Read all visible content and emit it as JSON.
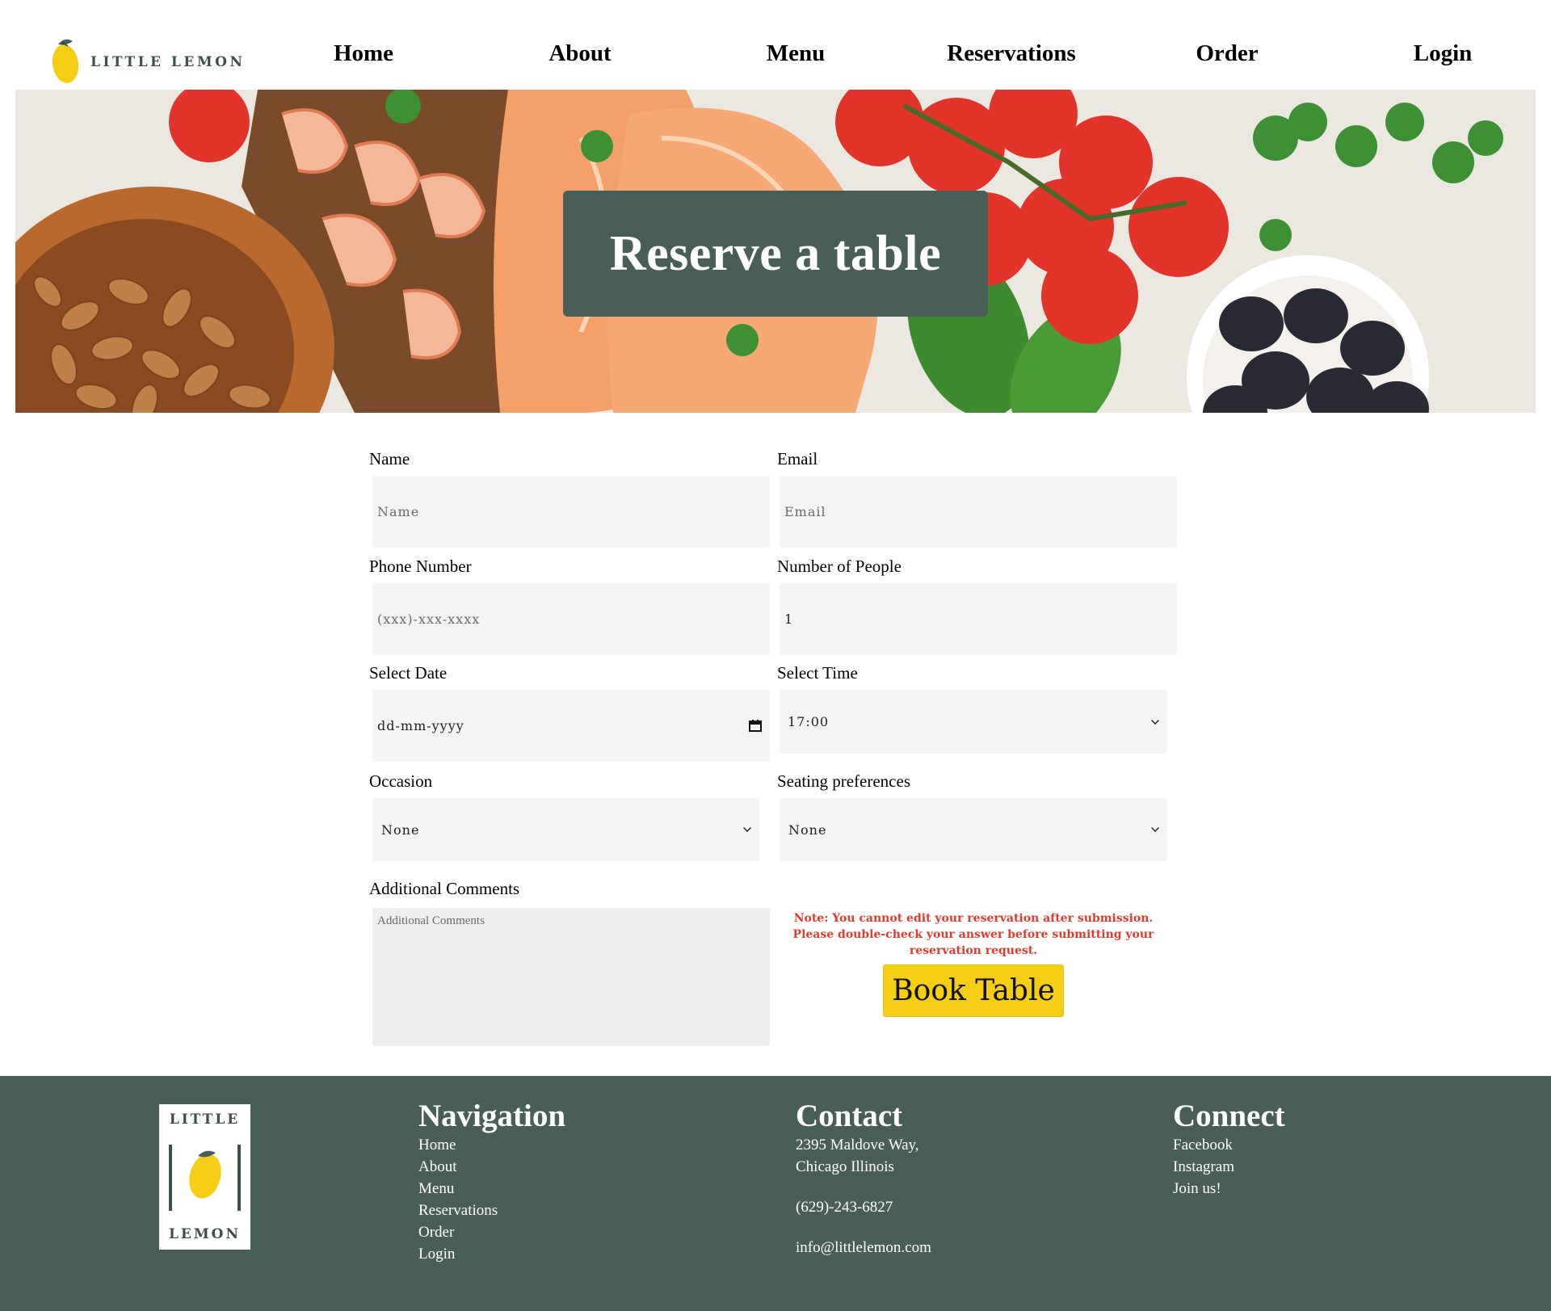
{
  "header": {
    "logo_text": "LITTLE LEMON",
    "nav": [
      {
        "label": "Home"
      },
      {
        "label": "About"
      },
      {
        "label": "Menu"
      },
      {
        "label": "Reservations"
      },
      {
        "label": "Order"
      },
      {
        "label": "Login"
      }
    ]
  },
  "hero": {
    "title": "Reserve a table"
  },
  "form": {
    "name": {
      "label": "Name",
      "placeholder": "Name"
    },
    "email": {
      "label": "Email",
      "placeholder": "Email"
    },
    "phone": {
      "label": "Phone Number",
      "placeholder": "(xxx)-xxx-xxxx"
    },
    "people": {
      "label": "Number of People",
      "value": "1"
    },
    "date": {
      "label": "Select Date",
      "placeholder": "dd-mm-yyyy"
    },
    "time": {
      "label": "Select Time",
      "value": "17:00"
    },
    "occasion": {
      "label": "Occasion",
      "value": "None"
    },
    "seating": {
      "label": "Seating preferences",
      "value": "None"
    },
    "comments": {
      "label": "Additional Comments",
      "placeholder": "Additional Comments"
    },
    "note": "Note: You cannot edit your reservation after submission. Please double-check your answer before submitting your reservation request.",
    "submit_label": "Book Table"
  },
  "footer": {
    "logo_top": "LITTLE",
    "logo_bottom": "LEMON",
    "navigation": {
      "title": "Navigation",
      "items": [
        "Home",
        "About",
        "Menu",
        "Reservations",
        "Order",
        "Login"
      ]
    },
    "contact": {
      "title": "Contact",
      "address_line1": "2395 Maldove Way,",
      "address_line2": "Chicago Illinois",
      "phone": "(629)-243-6827",
      "email": "info@littlelemon.com"
    },
    "connect": {
      "title": "Connect",
      "items": [
        "Facebook",
        "Instagram",
        "Join us!"
      ]
    }
  },
  "colors": {
    "primary_green": "#495e57",
    "accent_yellow": "#f4ce14",
    "note_red": "#e03a2f",
    "field_bg": "#f4f4f4"
  }
}
